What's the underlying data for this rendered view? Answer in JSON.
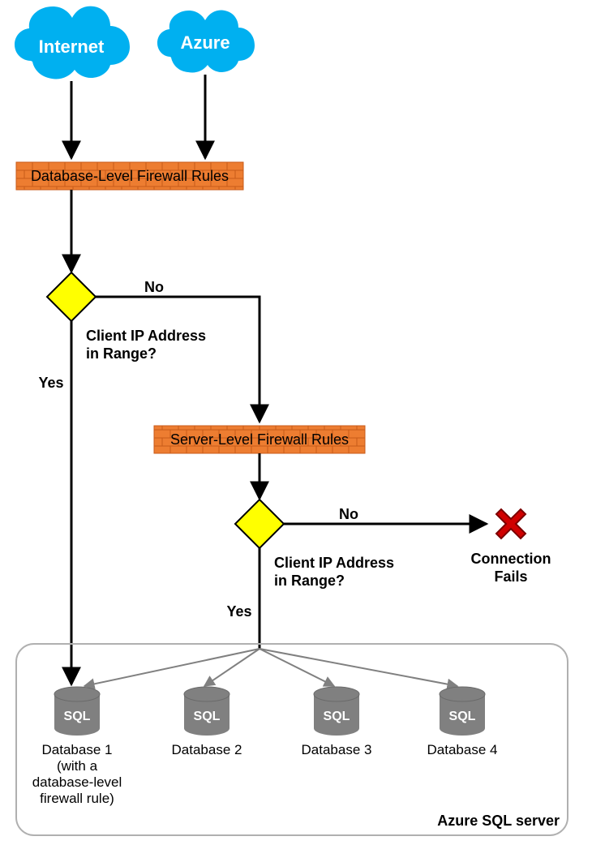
{
  "clouds": {
    "internet": "Internet",
    "azure": "Azure"
  },
  "rules": {
    "database_level": "Database-Level Firewall Rules",
    "server_level": "Server-Level Firewall Rules"
  },
  "decision": {
    "line1": "Client IP Address",
    "line2": "in Range?",
    "yes": "Yes",
    "no": "No"
  },
  "fail": {
    "line1": "Connection",
    "line2": "Fails"
  },
  "databases": {
    "db1_l1": "Database 1",
    "db1_l2": "(with a",
    "db1_l3": "database-level",
    "db1_l4": "firewall rule)",
    "db2": "Database 2",
    "db3": "Database 3",
    "db4": "Database 4",
    "sql": "SQL"
  },
  "server_box": "Azure SQL server",
  "colors": {
    "cloud": "#00b0f0",
    "brick_fill": "#ed7d31",
    "brick_line": "#c85a19",
    "diamond_fill": "#ffff00",
    "diamond_stroke": "#000000",
    "arrow": "#000000",
    "arrow_gray": "#808080",
    "db_fill": "#808080",
    "cross": "#d00000",
    "rounded_stroke": "#b0b0b0"
  }
}
